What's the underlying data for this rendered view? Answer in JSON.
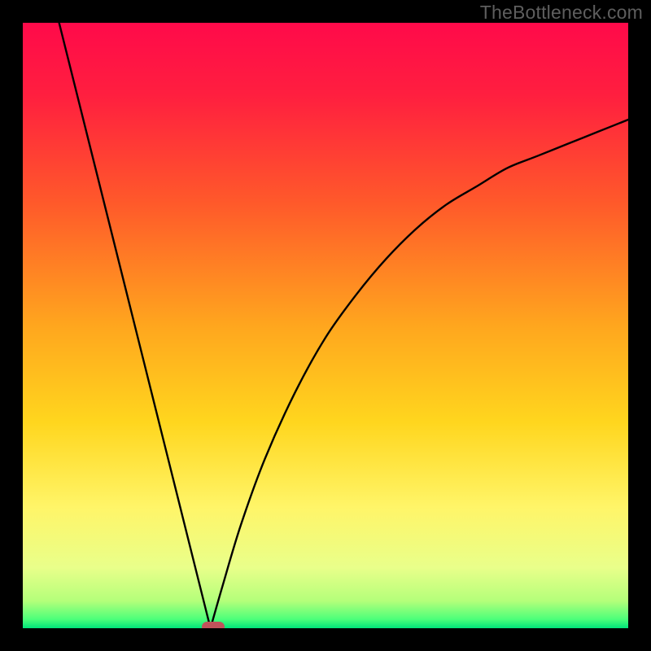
{
  "watermark": "TheBottleneck.com",
  "colors": {
    "frame": "#000000",
    "gradient_stops": [
      {
        "offset": 0.0,
        "color": "#ff0a4a"
      },
      {
        "offset": 0.12,
        "color": "#ff1f3f"
      },
      {
        "offset": 0.3,
        "color": "#ff5a2a"
      },
      {
        "offset": 0.5,
        "color": "#ffa61e"
      },
      {
        "offset": 0.66,
        "color": "#ffd61e"
      },
      {
        "offset": 0.8,
        "color": "#fff568"
      },
      {
        "offset": 0.9,
        "color": "#e9ff8a"
      },
      {
        "offset": 0.955,
        "color": "#b4ff7a"
      },
      {
        "offset": 0.985,
        "color": "#4dff7a"
      },
      {
        "offset": 1.0,
        "color": "#00e47a"
      }
    ],
    "curve": "#000000",
    "marker": "#c0535b"
  },
  "chart_data": {
    "type": "line",
    "title": "",
    "xlabel": "",
    "ylabel": "",
    "xlim": [
      0,
      100
    ],
    "ylim": [
      0,
      100
    ],
    "grid": false,
    "note": "Bottleneck-style V-curve. Minimum at x≈31 where curve touches bottom (y≈0). Left branch rises steeply to y≈100 at x≈6. Right branch rises with decreasing slope toward y≈84 at x=100.",
    "series": [
      {
        "name": "curve",
        "x": [
          6,
          10,
          14,
          18,
          22,
          26,
          29,
          31,
          33,
          36,
          40,
          45,
          50,
          55,
          60,
          65,
          70,
          75,
          80,
          85,
          90,
          95,
          100
        ],
        "y": [
          100,
          84,
          68,
          52,
          36,
          20,
          8,
          0,
          7,
          17,
          28,
          39,
          48,
          55,
          61,
          66,
          70,
          73,
          76,
          78,
          80,
          82,
          84
        ]
      }
    ],
    "marker": {
      "x": 31.5,
      "y": 0,
      "shape": "pill"
    }
  }
}
